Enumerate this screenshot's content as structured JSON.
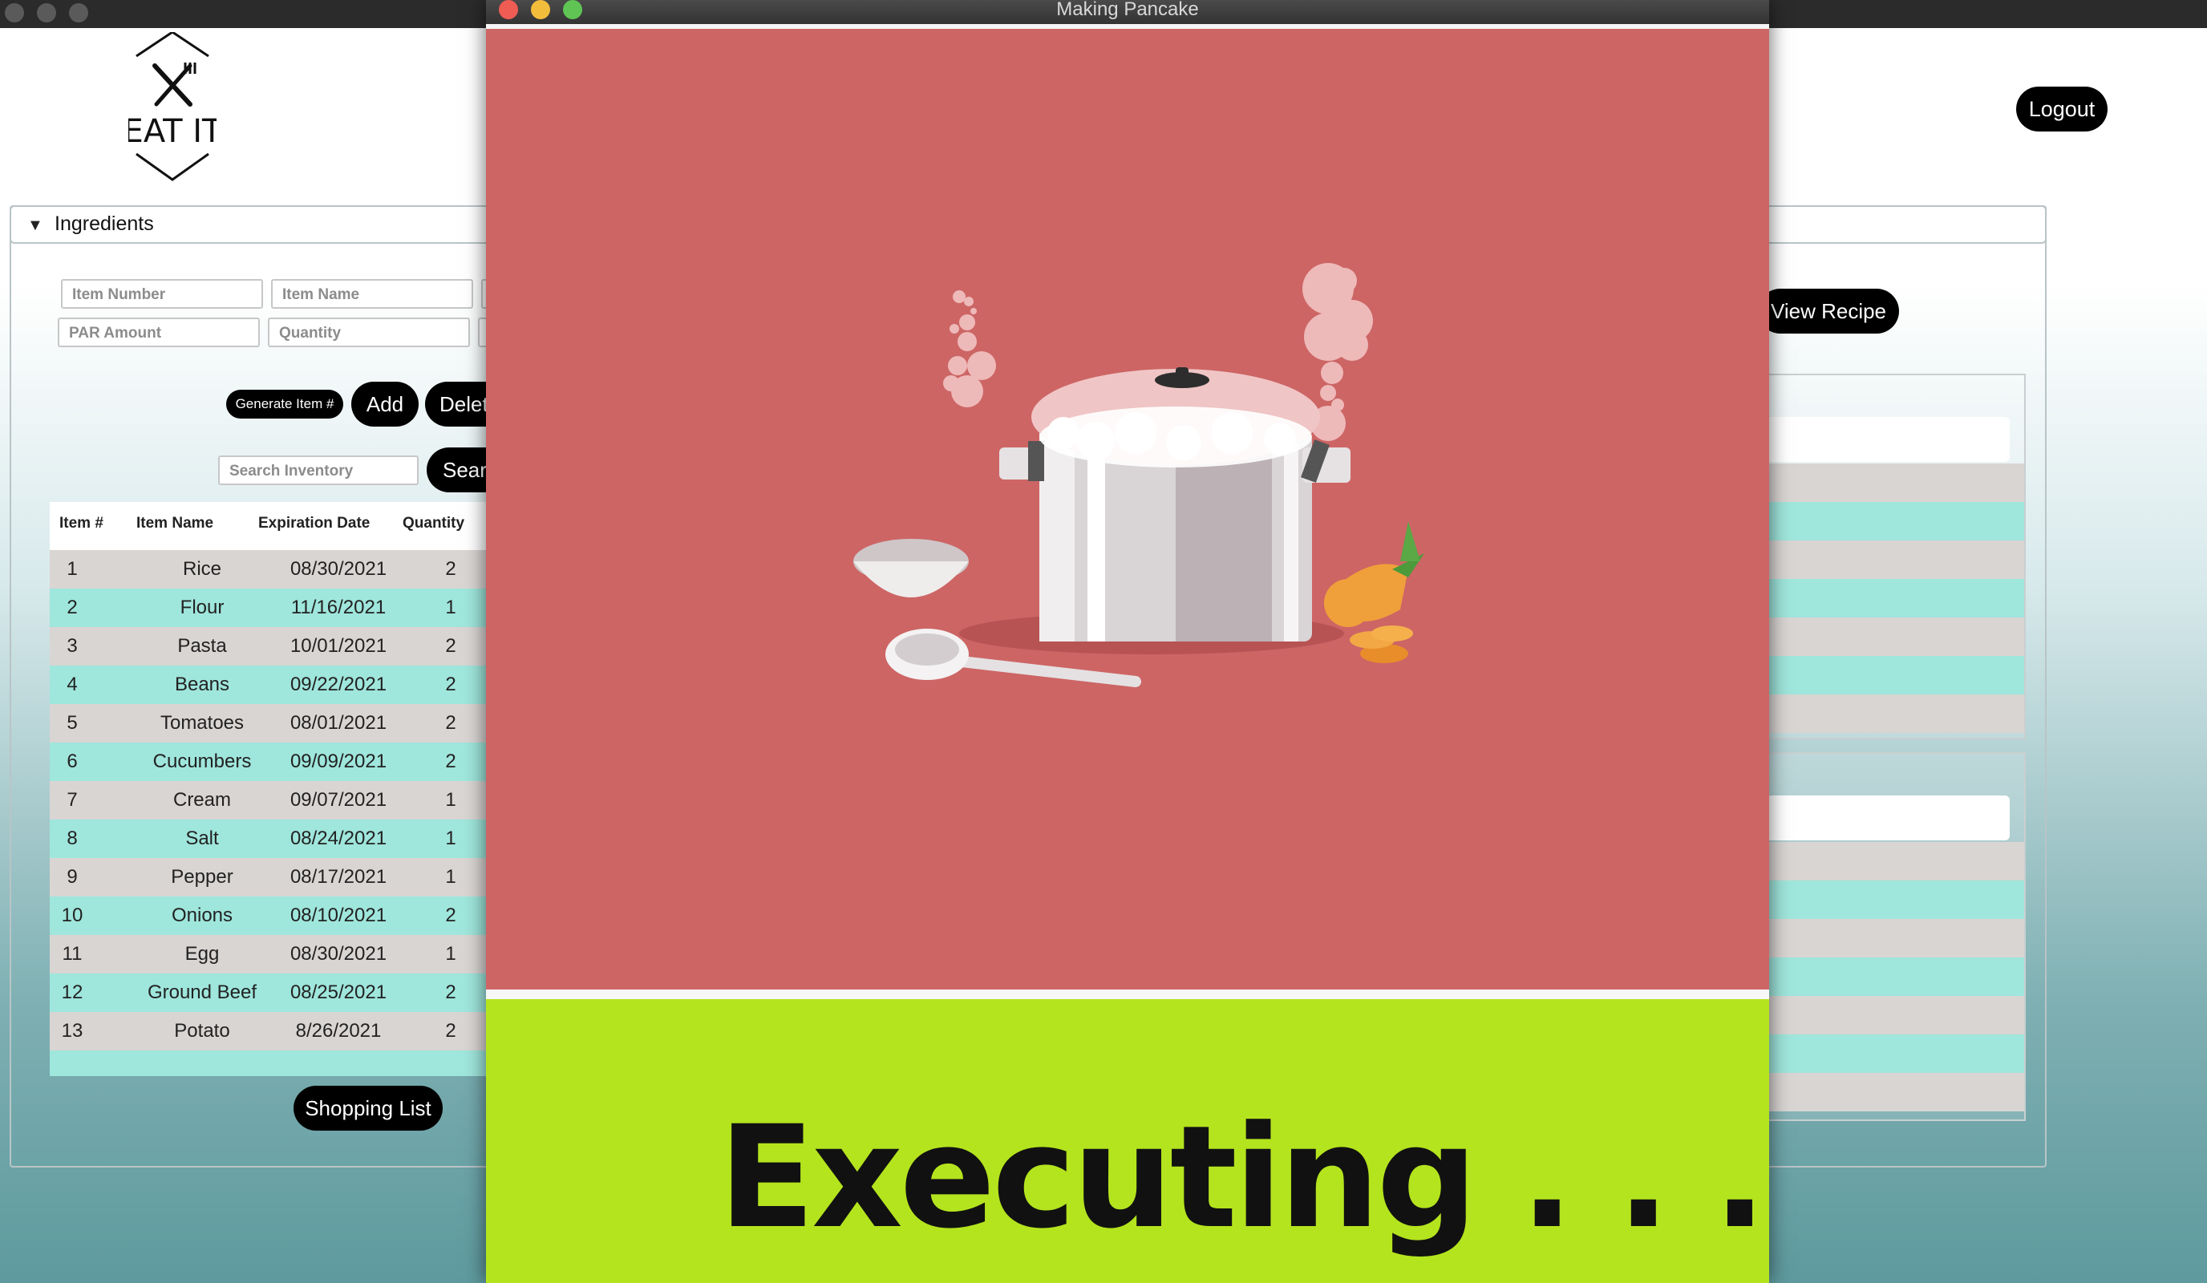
{
  "app": {
    "logo_text": "EAT IT",
    "logout_label": "Logout",
    "section_title": "Ingredients",
    "fields": {
      "item_number_placeholder": "Item Number",
      "item_name_placeholder": "Item Name",
      "par_amount_placeholder": "PAR Amount",
      "quantity_placeholder": "Quantity",
      "search_placeholder": "Search Inventory"
    },
    "buttons": {
      "generate_label": "Generate Item #",
      "add_label": "Add",
      "delete_label": "Delete",
      "search_label": "Search",
      "shopping_list_label": "Shopping List",
      "view_recipe_label": "View Recipe"
    },
    "table": {
      "headers": [
        "Item #",
        "Item Name",
        "Expiration Date",
        "Quantity"
      ],
      "rows": [
        {
          "num": "1",
          "name": "Rice",
          "date": "08/30/2021",
          "qty": "2"
        },
        {
          "num": "2",
          "name": "Flour",
          "date": "11/16/2021",
          "qty": "1"
        },
        {
          "num": "3",
          "name": "Pasta",
          "date": "10/01/2021",
          "qty": "2"
        },
        {
          "num": "4",
          "name": "Beans",
          "date": "09/22/2021",
          "qty": "2"
        },
        {
          "num": "5",
          "name": "Tomatoes",
          "date": "08/01/2021",
          "qty": "2"
        },
        {
          "num": "6",
          "name": "Cucumbers",
          "date": "09/09/2021",
          "qty": "2"
        },
        {
          "num": "7",
          "name": "Cream",
          "date": "09/07/2021",
          "qty": "1"
        },
        {
          "num": "8",
          "name": "Salt",
          "date": "08/24/2021",
          "qty": "1"
        },
        {
          "num": "9",
          "name": "Pepper",
          "date": "08/17/2021",
          "qty": "1"
        },
        {
          "num": "10",
          "name": "Onions",
          "date": "08/10/2021",
          "qty": "2"
        },
        {
          "num": "11",
          "name": "Egg",
          "date": "08/30/2021",
          "qty": "1"
        },
        {
          "num": "12",
          "name": "Ground Beef",
          "date": "08/25/2021",
          "qty": "2"
        },
        {
          "num": "13",
          "name": "Potato",
          "date": "8/26/2021",
          "qty": "2"
        }
      ]
    }
  },
  "dialog": {
    "title": "Making Pancake",
    "status_text": "Executing . . .",
    "illustration": "cooking-pot-illustration"
  },
  "colors": {
    "dialog_bg": "#cd6565",
    "status_bg": "#b4e41e",
    "row_gray": "#d9d5d3",
    "row_teal": "#9fe6dc"
  }
}
